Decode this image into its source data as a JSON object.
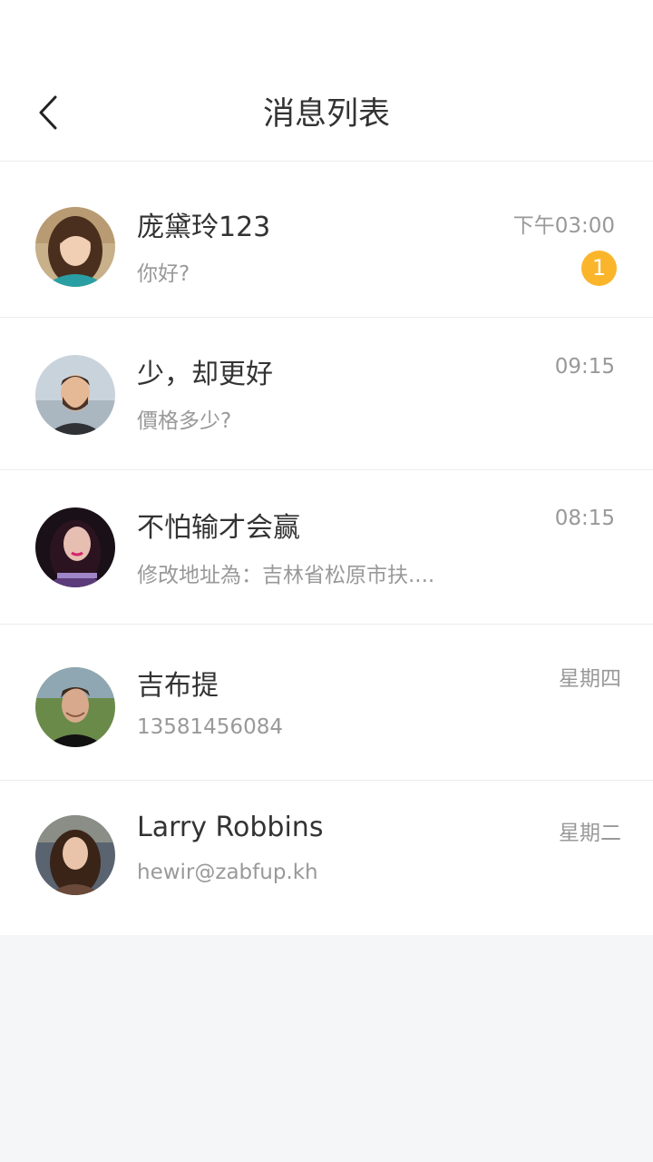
{
  "header": {
    "title": "消息列表",
    "back_icon": "chevron-left-icon"
  },
  "messages": [
    {
      "name": "庞黛玲123",
      "preview": "你好?",
      "time": "下午03:00",
      "unread": "1",
      "avatar_icon": "avatar-woman-long-hair"
    },
    {
      "name": "少，却更好",
      "preview": "價格多少?",
      "time": "09:15",
      "avatar_icon": "avatar-man-beard"
    },
    {
      "name": "不怕输才会赢",
      "preview": "修改地址為：吉林省松原市扶....",
      "time": "08:15",
      "avatar_icon": "avatar-woman-purple"
    },
    {
      "name": "吉布提",
      "preview": "13581456084",
      "time": "星期四",
      "avatar_icon": "avatar-man-outdoor"
    },
    {
      "name": "Larry Robbins",
      "preview": "hewir@zabfup.kh",
      "time": "星期二",
      "avatar_icon": "avatar-woman-brunette"
    }
  ],
  "colors": {
    "badge": "#fbb52b",
    "title": "#333333",
    "secondary": "#999999",
    "background": "#f5f6f8"
  }
}
